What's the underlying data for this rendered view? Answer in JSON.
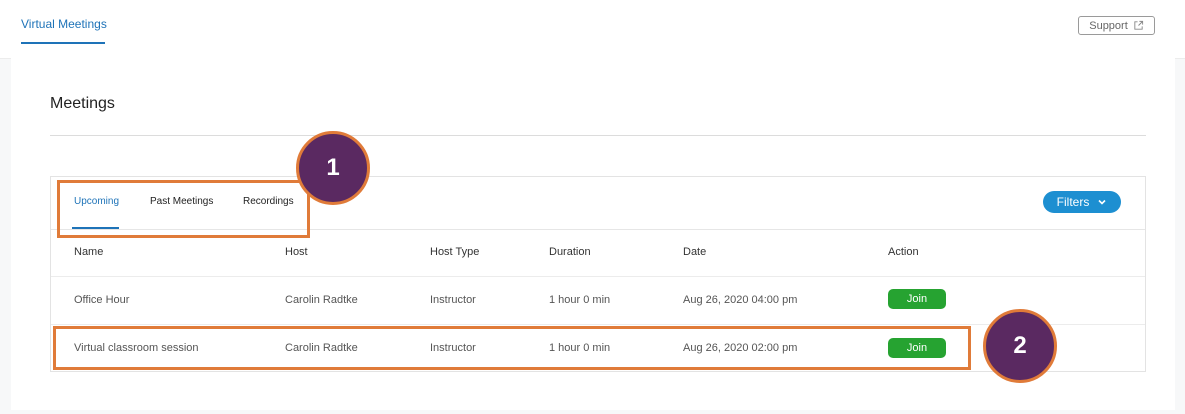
{
  "header": {
    "tab_label": "Virtual Meetings",
    "support_label": "Support",
    "support_icon": "external-link-icon"
  },
  "page": {
    "title": "Meetings"
  },
  "tabs": [
    {
      "label": "Upcoming",
      "active": true
    },
    {
      "label": "Past Meetings",
      "active": false
    },
    {
      "label": "Recordings",
      "active": false
    }
  ],
  "filters": {
    "label": "Filters",
    "icon": "chevron-down-icon",
    "color": "#1d8fd1"
  },
  "table": {
    "columns": [
      "Name",
      "Host",
      "Host Type",
      "Duration",
      "Date",
      "Action"
    ],
    "rows": [
      {
        "name": "Office Hour",
        "host": "Carolin Radtke",
        "host_type": "Instructor",
        "duration": "1 hour 0 min",
        "date": "Aug 26, 2020 04:00 pm",
        "action": "Join"
      },
      {
        "name": "Virtual classroom session",
        "host": "Carolin Radtke",
        "host_type": "Instructor",
        "duration": "1 hour 0 min",
        "date": "Aug 26, 2020 02:00 pm",
        "action": "Join"
      }
    ]
  },
  "callouts": [
    {
      "number": "1"
    },
    {
      "number": "2"
    }
  ],
  "colors": {
    "accent": "#1e73b8",
    "join": "#26a331",
    "callout_border": "#e07b39",
    "callout_fill": "#5a2961"
  }
}
